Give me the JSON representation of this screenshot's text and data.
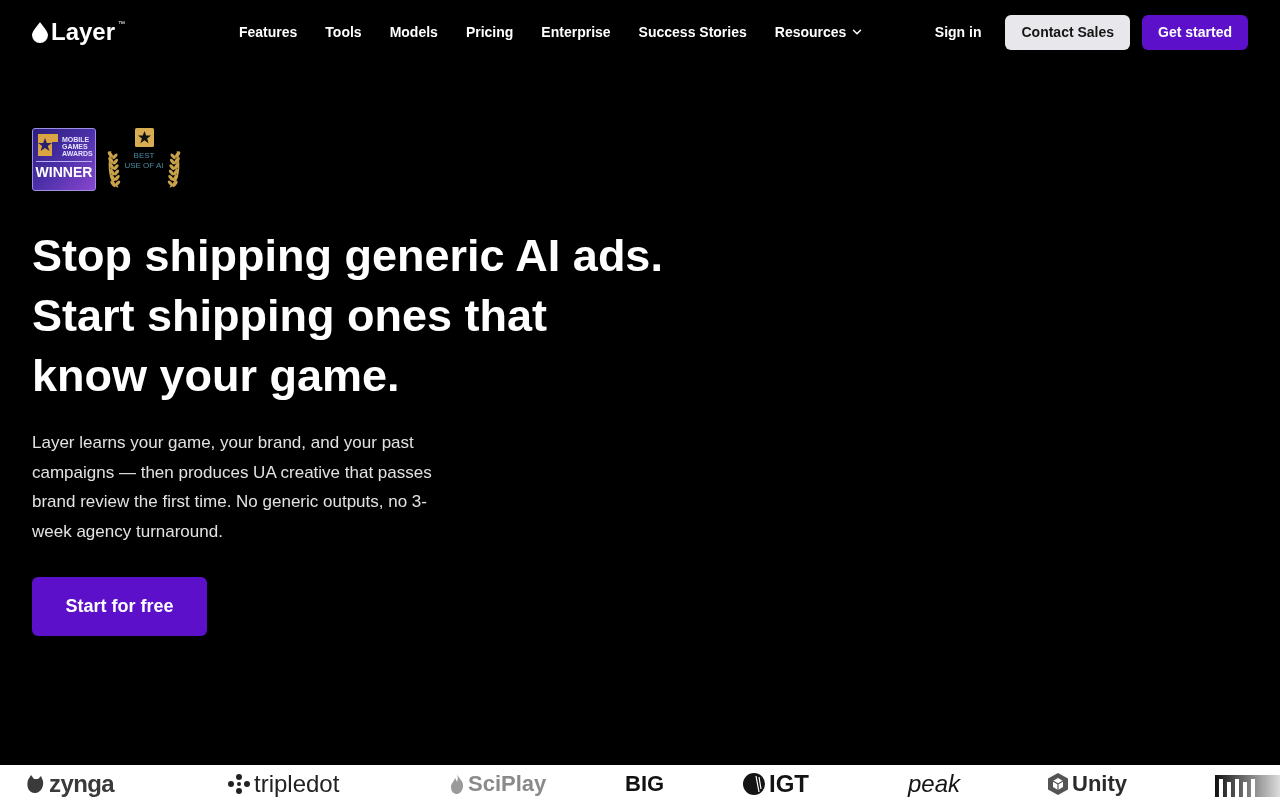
{
  "nav": {
    "logo": {
      "name": "Layer",
      "trademark": "™"
    },
    "links": [
      {
        "label": "Features",
        "has_dropdown": false
      },
      {
        "label": "Tools",
        "has_dropdown": false
      },
      {
        "label": "Models",
        "has_dropdown": false
      },
      {
        "label": "Pricing",
        "has_dropdown": false
      },
      {
        "label": "Enterprise",
        "has_dropdown": false
      },
      {
        "label": "Success Stories",
        "has_dropdown": false
      },
      {
        "label": "Resources",
        "has_dropdown": true
      }
    ],
    "actions": [
      {
        "label": "Sign in",
        "kind": "link"
      },
      {
        "label": "Contact Sales",
        "kind": "secondary"
      },
      {
        "label": "Get started",
        "kind": "primary"
      }
    ]
  },
  "hero": {
    "badges": [
      {
        "kind": "award",
        "lines": [
          "MOBILE",
          "GAMES",
          "AWARDS"
        ],
        "label": "WINNER"
      },
      {
        "kind": "laurel",
        "lines": [
          "BEST",
          "USE OF AI"
        ]
      }
    ],
    "headline_lines": [
      "Stop shipping generic AI ads.",
      "Start shipping ones that",
      "know your game."
    ],
    "description": "Layer learns your game, your brand, and your past campaigns — then produces UA creative that passes brand review the first time. No generic outputs, no 3-week agency turnaround.",
    "cta": {
      "label": "Start for free"
    }
  },
  "logo_strip": {
    "logos": [
      {
        "name": "zynga"
      },
      {
        "name": "tripledot"
      },
      {
        "name": "SciPlay"
      },
      {
        "name": "BIG"
      },
      {
        "name": "IGT"
      },
      {
        "name": "peak"
      },
      {
        "name": "Unity"
      }
    ]
  }
}
